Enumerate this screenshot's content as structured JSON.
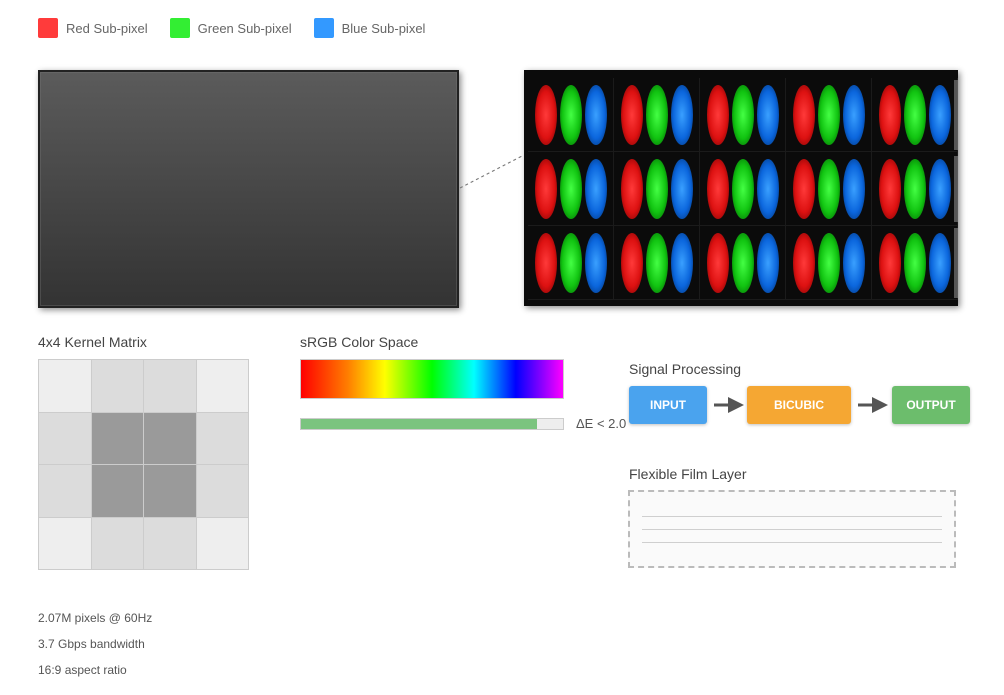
{
  "legend": [
    {
      "label": "Red Sub-pixel",
      "color": "#ff3b3b"
    },
    {
      "label": "Green Sub-pixel",
      "color": "#33ee33"
    },
    {
      "label": "Blue Sub-pixel",
      "color": "#3399ff"
    }
  ],
  "magnified_pixels": {
    "rows": 3,
    "columns": 5,
    "subpixel_order": [
      "red",
      "green",
      "blue"
    ]
  },
  "kernel": {
    "title": "4x4 Kernel Matrix",
    "cells": [
      [
        "#eeeeee",
        "#dcdcdc",
        "#dcdcdc",
        "#eeeeee"
      ],
      [
        "#dcdcdc",
        "#9a9a9a",
        "#9a9a9a",
        "#dcdcdc"
      ],
      [
        "#dcdcdc",
        "#9a9a9a",
        "#9a9a9a",
        "#dcdcdc"
      ],
      [
        "#eeeeee",
        "#dcdcdc",
        "#dcdcdc",
        "#eeeeee"
      ]
    ]
  },
  "color_space": {
    "title": "sRGB Color Space",
    "gamut_coverage": 0.9,
    "delta_e": "ΔE < 2.0"
  },
  "signal": {
    "title": "Signal Processing",
    "nodes": [
      {
        "label": "INPUT",
        "color": "#4aa3ee"
      },
      {
        "label": "BICUBIC",
        "color": "#f5a733"
      },
      {
        "label": "OUTPUT",
        "color": "#6cbd6c"
      }
    ]
  },
  "film": {
    "title": "Flexible Film Layer"
  },
  "stats": [
    "2.07M pixels @ 60Hz",
    "3.7 Gbps bandwidth",
    "16:9 aspect ratio"
  ]
}
